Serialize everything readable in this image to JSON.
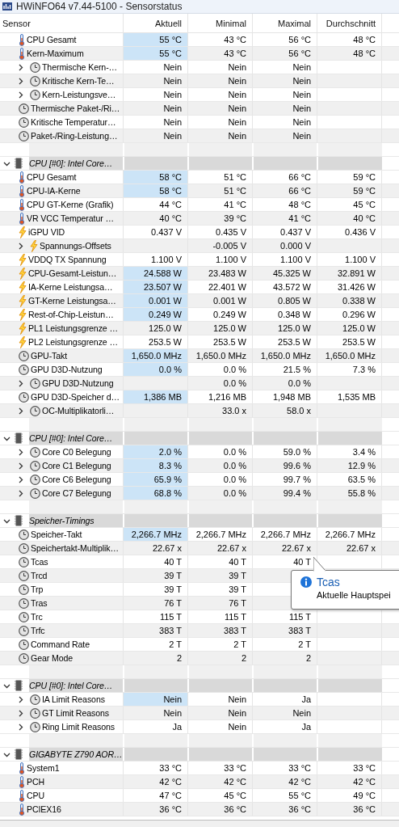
{
  "window": {
    "title": "HWiNFO64 v7.44-5100 - Sensorstatus"
  },
  "columns": [
    "Sensor",
    "Aktuell",
    "Minimal",
    "Maximal",
    "Durchschnitt"
  ],
  "sections": [
    {
      "rows": [
        {
          "kind": "temperature",
          "expandable": false,
          "label": "CPU Gesamt",
          "current": "55 °C",
          "min": "43 °C",
          "max": "56 °C",
          "avg": "48 °C",
          "highlighted": true
        },
        {
          "kind": "temperature",
          "expandable": false,
          "label": "Kern-Maximum",
          "current": "55 °C",
          "min": "43 °C",
          "max": "56 °C",
          "avg": "48 °C",
          "highlighted": true
        },
        {
          "kind": "status",
          "expandable": true,
          "label": "Thermische Kern-…",
          "current": "Nein",
          "min": "Nein",
          "max": "Nein",
          "highlighted": false
        },
        {
          "kind": "status",
          "expandable": true,
          "label": "Kritische Kern-Te…",
          "current": "Nein",
          "min": "Nein",
          "max": "Nein",
          "highlighted": false
        },
        {
          "kind": "status",
          "expandable": true,
          "label": "Kern-Leistungsve…",
          "current": "Nein",
          "min": "Nein",
          "max": "Nein",
          "highlighted": false
        },
        {
          "kind": "status",
          "expandable": false,
          "label": "Thermische Paket-/Ri…",
          "current": "Nein",
          "min": "Nein",
          "max": "Nein",
          "highlighted": false
        },
        {
          "kind": "status",
          "expandable": false,
          "label": "Kritische Temperatur…",
          "current": "Nein",
          "min": "Nein",
          "max": "Nein",
          "highlighted": false
        },
        {
          "kind": "status",
          "expandable": false,
          "label": "Paket-/Ring-Leistung…",
          "current": "Nein",
          "min": "Nein",
          "max": "Nein",
          "highlighted": false
        }
      ]
    },
    {
      "title": "CPU [#0]: Intel Core…",
      "expanded": true,
      "rows": [
        {
          "kind": "temperature",
          "expandable": false,
          "label": "CPU Gesamt",
          "current": "58 °C",
          "min": "51 °C",
          "max": "66 °C",
          "avg": "59 °C",
          "highlighted": true
        },
        {
          "kind": "temperature",
          "expandable": false,
          "label": "CPU-IA-Kerne",
          "current": "58 °C",
          "min": "51 °C",
          "max": "66 °C",
          "avg": "59 °C",
          "highlighted": true
        },
        {
          "kind": "temperature",
          "expandable": false,
          "label": "CPU GT-Kerne (Grafik)",
          "current": "44 °C",
          "min": "41 °C",
          "max": "48 °C",
          "avg": "45 °C",
          "highlighted": false
        },
        {
          "kind": "temperature",
          "expandable": false,
          "label": "VR VCC Temperatur …",
          "current": "40 °C",
          "min": "39 °C",
          "max": "41 °C",
          "avg": "40 °C",
          "highlighted": false
        },
        {
          "kind": "electrical",
          "expandable": false,
          "label": "iGPU VID",
          "current": "0.437 V",
          "min": "0.435 V",
          "max": "0.437 V",
          "avg": "0.436 V",
          "highlighted": false
        },
        {
          "kind": "electrical",
          "expandable": true,
          "label": "Spannungs-Offsets",
          "min": "-0.005 V",
          "max": "0.000 V",
          "highlighted": false
        },
        {
          "kind": "electrical",
          "expandable": false,
          "label": "VDDQ TX Spannung",
          "current": "1.100 V",
          "min": "1.100 V",
          "max": "1.100 V",
          "avg": "1.100 V",
          "highlighted": false
        },
        {
          "kind": "electrical",
          "expandable": false,
          "label": "CPU-Gesamt-Leistun…",
          "current": "24.588 W",
          "min": "23.483 W",
          "max": "45.325 W",
          "avg": "32.891 W",
          "highlighted": true
        },
        {
          "kind": "electrical",
          "expandable": false,
          "label": "IA-Kerne Leistungsa…",
          "current": "23.507 W",
          "min": "22.401 W",
          "max": "43.572 W",
          "avg": "31.426 W",
          "highlighted": true
        },
        {
          "kind": "electrical",
          "expandable": false,
          "label": "GT-Kerne Leistungsa…",
          "current": "0.001 W",
          "min": "0.001 W",
          "max": "0.805 W",
          "avg": "0.338 W",
          "highlighted": true
        },
        {
          "kind": "electrical",
          "expandable": false,
          "label": "Rest-of-Chip-Leistun…",
          "current": "0.249 W",
          "min": "0.249 W",
          "max": "0.348 W",
          "avg": "0.296 W",
          "highlighted": true
        },
        {
          "kind": "electrical",
          "expandable": false,
          "label": "PL1 Leistungsgrenze …",
          "current": "125.0 W",
          "min": "125.0 W",
          "max": "125.0 W",
          "avg": "125.0 W",
          "highlighted": false
        },
        {
          "kind": "electrical",
          "expandable": false,
          "label": "PL2 Leistungsgrenze …",
          "current": "253.5 W",
          "min": "253.5 W",
          "max": "253.5 W",
          "avg": "253.5 W",
          "highlighted": false
        },
        {
          "kind": "status",
          "expandable": false,
          "label": "GPU-Takt",
          "current": "1,650.0 MHz",
          "min": "1,650.0 MHz",
          "max": "1,650.0 MHz",
          "avg": "1,650.0 MHz",
          "highlighted": true
        },
        {
          "kind": "status",
          "expandable": false,
          "label": "GPU D3D-Nutzung",
          "current": "0.0 %",
          "min": "0.0 %",
          "max": "21.5 %",
          "avg": "7.3 %",
          "highlighted": true
        },
        {
          "kind": "status",
          "expandable": true,
          "label": "GPU D3D-Nutzung",
          "min": "0.0 %",
          "max": "0.0 %",
          "highlighted": false
        },
        {
          "kind": "status",
          "expandable": false,
          "label": "GPU D3D-Speicher d…",
          "current": "1,386 MB",
          "min": "1,216 MB",
          "max": "1,948 MB",
          "avg": "1,535 MB",
          "highlighted": true
        },
        {
          "kind": "status",
          "expandable": true,
          "label": "OC-Multiplikatorli…",
          "min": "33.0 x",
          "max": "58.0 x",
          "highlighted": false
        }
      ]
    },
    {
      "title": "CPU [#0]: Intel Core…",
      "expanded": true,
      "rows": [
        {
          "kind": "status",
          "expandable": true,
          "label": "Core C0 Belegung",
          "current": "2.0 %",
          "min": "0.0 %",
          "max": "59.0 %",
          "avg": "3.4 %",
          "highlighted": true
        },
        {
          "kind": "status",
          "expandable": true,
          "label": "Core C1 Belegung",
          "current": "8.3 %",
          "min": "0.0 %",
          "max": "99.6 %",
          "avg": "12.9 %",
          "highlighted": true
        },
        {
          "kind": "status",
          "expandable": true,
          "label": "Core C6 Belegung",
          "current": "65.9 %",
          "min": "0.0 %",
          "max": "99.7 %",
          "avg": "63.5 %",
          "highlighted": true
        },
        {
          "kind": "status",
          "expandable": true,
          "label": "Core C7 Belegung",
          "current": "68.8 %",
          "min": "0.0 %",
          "max": "99.4 %",
          "avg": "55.8 %",
          "highlighted": true
        }
      ]
    },
    {
      "title": "Speicher-Timings",
      "expanded": true,
      "rows": [
        {
          "kind": "status",
          "expandable": false,
          "label": "Speicher-Takt",
          "current": "2,266.7 MHz",
          "min": "2,266.7 MHz",
          "max": "2,266.7 MHz",
          "avg": "2,266.7 MHz",
          "highlighted": true
        },
        {
          "kind": "status",
          "expandable": false,
          "label": "Speichertakt-Multiplik…",
          "current": "22.67 x",
          "min": "22.67 x",
          "max": "22.67 x",
          "avg": "22.67 x",
          "highlighted": false
        },
        {
          "kind": "status",
          "expandable": false,
          "label": "Tcas",
          "current": "40 T",
          "min": "40 T",
          "max": "40 T",
          "highlighted": false
        },
        {
          "kind": "status",
          "expandable": false,
          "label": "Trcd",
          "current": "39 T",
          "min": "39 T",
          "highlighted": false
        },
        {
          "kind": "status",
          "expandable": false,
          "label": "Trp",
          "current": "39 T",
          "min": "39 T",
          "highlighted": false
        },
        {
          "kind": "status",
          "expandable": false,
          "label": "Tras",
          "current": "76 T",
          "min": "76 T",
          "highlighted": false
        },
        {
          "kind": "status",
          "expandable": false,
          "label": "Trc",
          "current": "115 T",
          "min": "115 T",
          "max": "115 T",
          "highlighted": false
        },
        {
          "kind": "status",
          "expandable": false,
          "label": "Trfc",
          "current": "383 T",
          "min": "383 T",
          "max": "383 T",
          "highlighted": false
        },
        {
          "kind": "status",
          "expandable": false,
          "label": "Command Rate",
          "current": "2 T",
          "min": "2 T",
          "max": "2 T",
          "highlighted": false
        },
        {
          "kind": "status",
          "expandable": false,
          "label": "Gear Mode",
          "current": "2",
          "min": "2",
          "max": "2",
          "highlighted": false
        }
      ]
    },
    {
      "title": "CPU [#0]: Intel Core…",
      "expanded": true,
      "rows": [
        {
          "kind": "status",
          "expandable": true,
          "label": "IA Limit Reasons",
          "current": "Nein",
          "min": "Nein",
          "max": "Ja",
          "highlighted": true
        },
        {
          "kind": "status",
          "expandable": true,
          "label": "GT Limit Reasons",
          "current": "Nein",
          "min": "Nein",
          "max": "Nein",
          "highlighted": false
        },
        {
          "kind": "status",
          "expandable": true,
          "label": "Ring Limit Reasons",
          "current": "Ja",
          "min": "Nein",
          "max": "Ja",
          "highlighted": false
        }
      ]
    },
    {
      "title": "GIGABYTE Z790 AOR…",
      "expanded": true,
      "rows": [
        {
          "kind": "temperature",
          "expandable": false,
          "label": "System1",
          "current": "33 °C",
          "min": "33 °C",
          "max": "33 °C",
          "avg": "33 °C",
          "highlighted": false
        },
        {
          "kind": "temperature",
          "expandable": false,
          "label": "PCH",
          "current": "42 °C",
          "min": "42 °C",
          "max": "42 °C",
          "avg": "42 °C",
          "highlighted": false
        },
        {
          "kind": "temperature",
          "expandable": false,
          "label": "CPU",
          "current": "47 °C",
          "min": "45 °C",
          "max": "55 °C",
          "avg": "49 °C",
          "highlighted": false
        },
        {
          "kind": "temperature",
          "expandable": false,
          "label": "PCIEX16",
          "current": "36 °C",
          "min": "36 °C",
          "max": "36 °C",
          "avg": "36 °C",
          "highlighted": false
        }
      ]
    }
  ],
  "tooltip": {
    "title": "Tcas",
    "text": "Aktuelle Hauptspei"
  }
}
